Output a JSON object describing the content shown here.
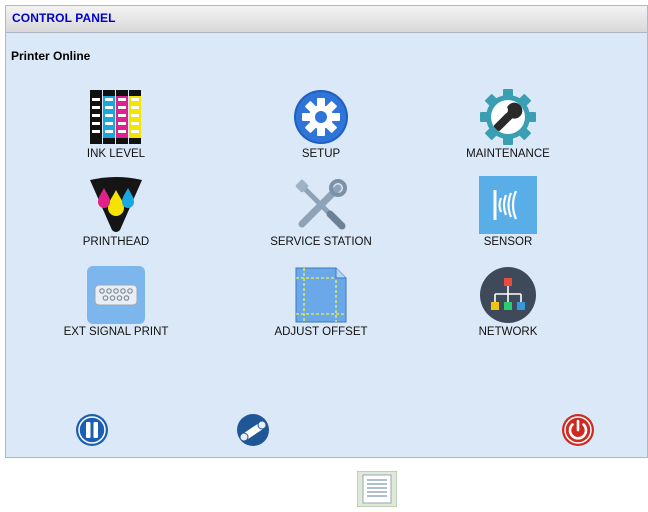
{
  "panel": {
    "title": "CONTROL PANEL",
    "status": "Printer Online"
  },
  "tiles": [
    {
      "label": "INK LEVEL",
      "icon": "ink-level-icon"
    },
    {
      "label": "SETUP",
      "icon": "gear-icon"
    },
    {
      "label": "MAINTENANCE",
      "icon": "wrench-gear-icon"
    },
    {
      "label": "PRINTHEAD",
      "icon": "printhead-icon"
    },
    {
      "label": "SERVICE STATION",
      "icon": "tools-icon"
    },
    {
      "label": "SENSOR",
      "icon": "sensor-wave-icon"
    },
    {
      "label": "EXT SIGNAL PRINT",
      "icon": "ext-signal-icon"
    },
    {
      "label": "ADJUST OFFSET",
      "icon": "adjust-offset-icon"
    },
    {
      "label": "NETWORK",
      "icon": "network-icon"
    }
  ],
  "controls": {
    "pause": "pause-icon",
    "feed": "paper-roll-icon",
    "power": "power-icon"
  },
  "footer": {
    "icon": "document-list-icon"
  },
  "colors": {
    "panel_bg": "#dbe8f8",
    "title_text": "#0000cc",
    "accent_blue": "#1565c0",
    "power_red": "#d32f2f"
  }
}
